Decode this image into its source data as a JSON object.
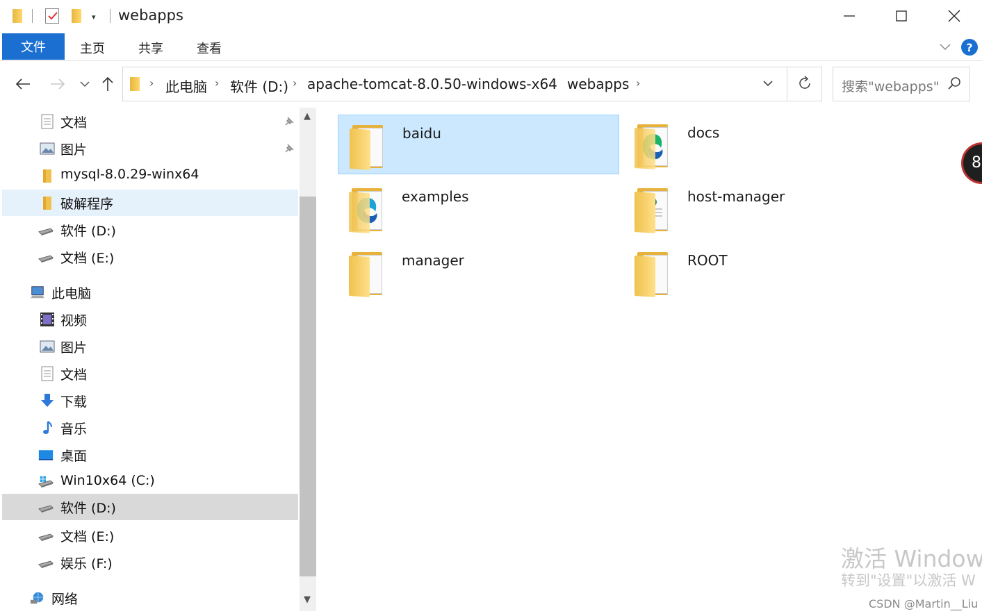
{
  "window": {
    "title": "webapps"
  },
  "ribbon": {
    "tabs": [
      "文件",
      "主页",
      "共享",
      "查看"
    ]
  },
  "address": {
    "crumbs": [
      "此电脑",
      "软件 (D:)",
      "apache-tomcat-8.0.50-windows-x64",
      "webapps"
    ]
  },
  "search": {
    "placeholder": "搜索\"webapps\""
  },
  "sidebar": {
    "items": [
      {
        "label": "文档",
        "icon": "document-icon",
        "pinned": true
      },
      {
        "label": "图片",
        "icon": "pictures-icon",
        "pinned": true
      },
      {
        "label": "mysql-8.0.29-winx64",
        "icon": "folder-icon"
      },
      {
        "label": "破解程序",
        "icon": "folder-icon"
      },
      {
        "label": "软件 (D:)",
        "icon": "drive-icon"
      },
      {
        "label": "文档 (E:)",
        "icon": "drive-icon"
      },
      {
        "label": "此电脑",
        "icon": "computer-icon"
      },
      {
        "label": "视频",
        "icon": "video-icon"
      },
      {
        "label": "图片",
        "icon": "pictures-icon"
      },
      {
        "label": "文档",
        "icon": "document-icon"
      },
      {
        "label": "下载",
        "icon": "download-icon"
      },
      {
        "label": "音乐",
        "icon": "music-icon"
      },
      {
        "label": "桌面",
        "icon": "desktop-icon"
      },
      {
        "label": "Win10x64 (C:)",
        "icon": "windows-drive-icon"
      },
      {
        "label": "软件 (D:)",
        "icon": "drive-icon"
      },
      {
        "label": "文档 (E:)",
        "icon": "drive-icon"
      },
      {
        "label": "娱乐 (F:)",
        "icon": "drive-icon"
      },
      {
        "label": "网络",
        "icon": "network-icon"
      }
    ]
  },
  "content": {
    "folders": [
      {
        "name": "baidu",
        "selected": true
      },
      {
        "name": "docs"
      },
      {
        "name": "examples"
      },
      {
        "name": "host-manager"
      },
      {
        "name": "manager"
      },
      {
        "name": "ROOT"
      }
    ]
  },
  "overlay": {
    "badge": "8",
    "watermark_line1": "激活 Window",
    "watermark_line2": "转到\"设置\"以激活 W",
    "credit": "CSDN @Martin__Liu"
  },
  "colors": {
    "accent": "#1a6fd1",
    "selection": "#cce8ff",
    "folder": "#f0c14e"
  }
}
